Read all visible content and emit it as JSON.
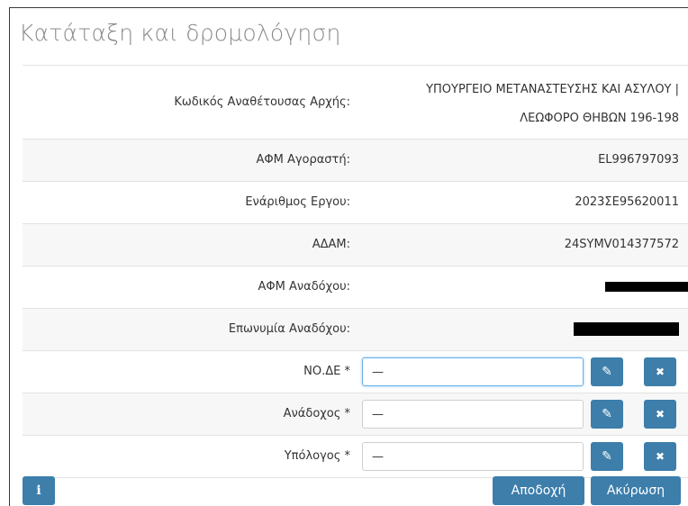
{
  "dialog": {
    "title": "Κατάταξη και δρομολόγηση"
  },
  "rows": {
    "contracting_authority": {
      "label": "Κωδικός Αναθέτουσας Αρχής:",
      "value_line1": "ΥΠΟΥΡΓΕΙΟ ΜΕΤΑΝΑΣΤΕΥΣΗΣ ΚΑΙ ΑΣΥΛΟΥ |",
      "value_line2": "ΛΕΩΦΟΡΟ ΘΗΒΩΝ 196-198"
    },
    "buyer_vat": {
      "label": "ΑΦΜ Αγοραστή:",
      "value": "EL996797093"
    },
    "project_code": {
      "label": "Ενάριθμος Εργου:",
      "value": "2023ΣΕ95620011"
    },
    "adam": {
      "label": "ΑΔΑΜ:",
      "value": "24SYMV014377572"
    },
    "contractor_vat": {
      "label": "ΑΦΜ Αναδόχου:"
    },
    "contractor_name": {
      "label": "Επωνυμία Αναδόχου:"
    },
    "node": {
      "label": "ΝΟ.ΔΕ *",
      "value": "—"
    },
    "contractor": {
      "label": "Ανάδοχος *",
      "value": "—"
    },
    "accountable": {
      "label": "Υπόλογος *",
      "value": "—"
    }
  },
  "icons": {
    "edit": "✎",
    "clear": "✖",
    "info": "i"
  },
  "footer": {
    "accept_label": "Αποδοχή",
    "cancel_label": "Ακύρωση"
  },
  "colors": {
    "primary_button": "#3d7eaa",
    "title_gray": "#8a8a8a"
  }
}
